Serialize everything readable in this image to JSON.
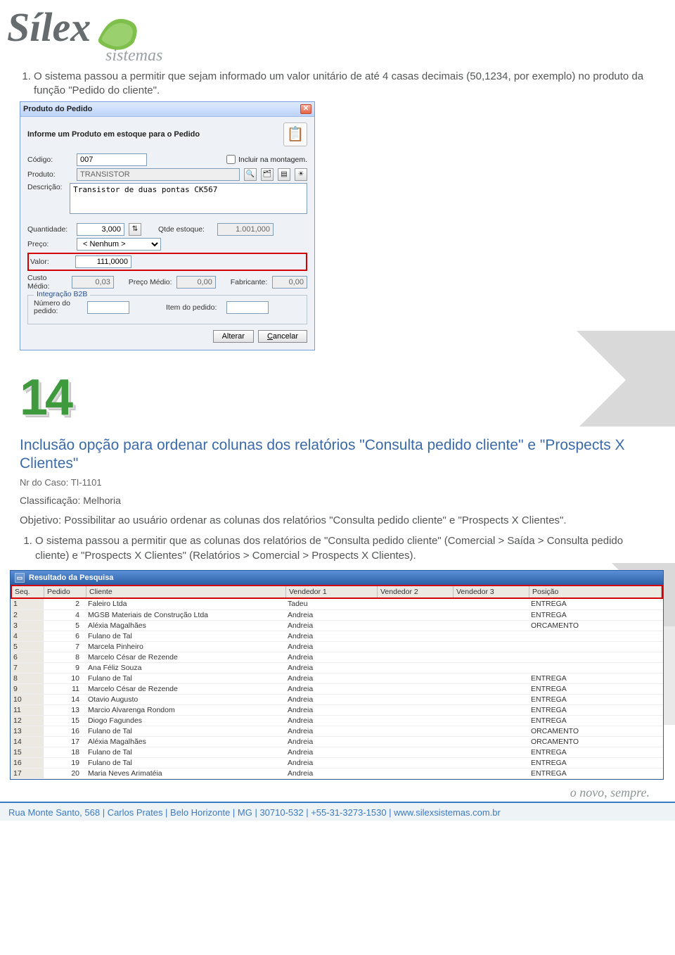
{
  "logo": {
    "main": "Sílex",
    "sub": "sistemas"
  },
  "intro_item": "O sistema passou a permitir que sejam informado um valor unitário de até 4 casas decimais (50,1234, por exemplo) no produto da função \"Pedido do cliente\".",
  "dialog": {
    "title": "Produto do Pedido",
    "instruction": "Informe um Produto em estoque para o Pedido",
    "labels": {
      "codigo": "Código:",
      "produto": "Produto:",
      "descricao": "Descrição:",
      "quantidade": "Quantidade:",
      "qtde_estoque": "Qtde estoque:",
      "preco": "Preço:",
      "valor": "Valor:",
      "custo_medio": "Custo Médio:",
      "preco_medio": "Preço Médio:",
      "fabricante": "Fabricante:",
      "integracao": "Integração B2B",
      "num_pedido": "Número do pedido:",
      "item_pedido": "Item do pedido:",
      "incluir": "Incluir na montagem."
    },
    "values": {
      "codigo": "007",
      "produto": "TRANSISTOR",
      "descricao": "Transistor de duas pontas CK567",
      "quantidade": "3,000",
      "qtde_estoque": "1.001,000",
      "preco": "< Nenhum >",
      "valor": "111,0000",
      "custo_medio": "0,03",
      "preco_medio": "0,00",
      "fabricante": "0,00",
      "num_pedido": "",
      "item_pedido": ""
    },
    "buttons": {
      "alterar": "Alterar",
      "cancelar": "Cancelar"
    }
  },
  "badge_number": "14",
  "section": {
    "heading": "Inclusão opção para ordenar colunas dos relatórios \"Consulta pedido cliente\" e \"Prospects X Clientes\"",
    "case_label": "Nr do Caso:",
    "case_value": "TI-1101",
    "class_label": "Classificação:",
    "class_value": "Melhoria",
    "objective": "Objetivo: Possibilitar ao usuário ordenar as colunas dos relatórios \"Consulta pedido cliente\" e \"Prospects X Clientes\".",
    "item1": "O sistema passou a permitir que as colunas dos relatórios de \"Consulta pedido cliente\" (Comercial > Saída > Consulta pedido cliente) e \"Prospects X Clientes\" (Relatórios > Comercial > Prospects X Clientes)."
  },
  "result": {
    "title": "Resultado da Pesquisa",
    "columns": [
      "Seq.",
      "Pedido",
      "Cliente",
      "Vendedor 1",
      "Vendedor 2",
      "Vendedor 3",
      "Posição"
    ],
    "rows": [
      [
        "1",
        "2",
        "Faleiro Ltda",
        "Tadeu",
        "",
        "",
        "ENTREGA"
      ],
      [
        "2",
        "4",
        "MGSB Materiais de Construção Ltda",
        "Andreia",
        "",
        "",
        "ENTREGA"
      ],
      [
        "3",
        "5",
        "Aléxia Magalhães",
        "Andreia",
        "",
        "",
        "ORCAMENTO"
      ],
      [
        "4",
        "6",
        "Fulano de Tal",
        "Andreia",
        "",
        "",
        ""
      ],
      [
        "5",
        "7",
        "Marcela Pinheiro",
        "Andreia",
        "",
        "",
        ""
      ],
      [
        "6",
        "8",
        "Marcelo César de Rezende",
        "Andreia",
        "",
        "",
        ""
      ],
      [
        "7",
        "9",
        "Ana Féliz Souza",
        "Andreia",
        "",
        "",
        ""
      ],
      [
        "8",
        "10",
        "Fulano de Tal",
        "Andreia",
        "",
        "",
        "ENTREGA"
      ],
      [
        "9",
        "11",
        "Marcelo César de Rezende",
        "Andreia",
        "",
        "",
        "ENTREGA"
      ],
      [
        "10",
        "14",
        "Otavio Augusto",
        "Andreia",
        "",
        "",
        "ENTREGA"
      ],
      [
        "11",
        "13",
        "Marcio Alvarenga Rondom",
        "Andreia",
        "",
        "",
        "ENTREGA"
      ],
      [
        "12",
        "15",
        "Diogo Fagundes",
        "Andreia",
        "",
        "",
        "ENTREGA"
      ],
      [
        "13",
        "16",
        "Fulano de Tal",
        "Andreia",
        "",
        "",
        "ORCAMENTO"
      ],
      [
        "14",
        "17",
        "Aléxia Magalhães",
        "Andreia",
        "",
        "",
        "ORCAMENTO"
      ],
      [
        "15",
        "18",
        "Fulano de Tal",
        "Andreia",
        "",
        "",
        "ENTREGA"
      ],
      [
        "16",
        "19",
        "Fulano de Tal",
        "Andreia",
        "",
        "",
        "ENTREGA"
      ],
      [
        "17",
        "20",
        "Maria Neves Arimatéia",
        "Andreia",
        "",
        "",
        "ENTREGA"
      ]
    ]
  },
  "footer": {
    "tagline": "o novo, sempre.",
    "address": "Rua Monte Santo, 568 | Carlos Prates | Belo Horizonte | MG | 30710-532 | +55-31-3273-1530 | www.silexsistemas.com.br"
  }
}
